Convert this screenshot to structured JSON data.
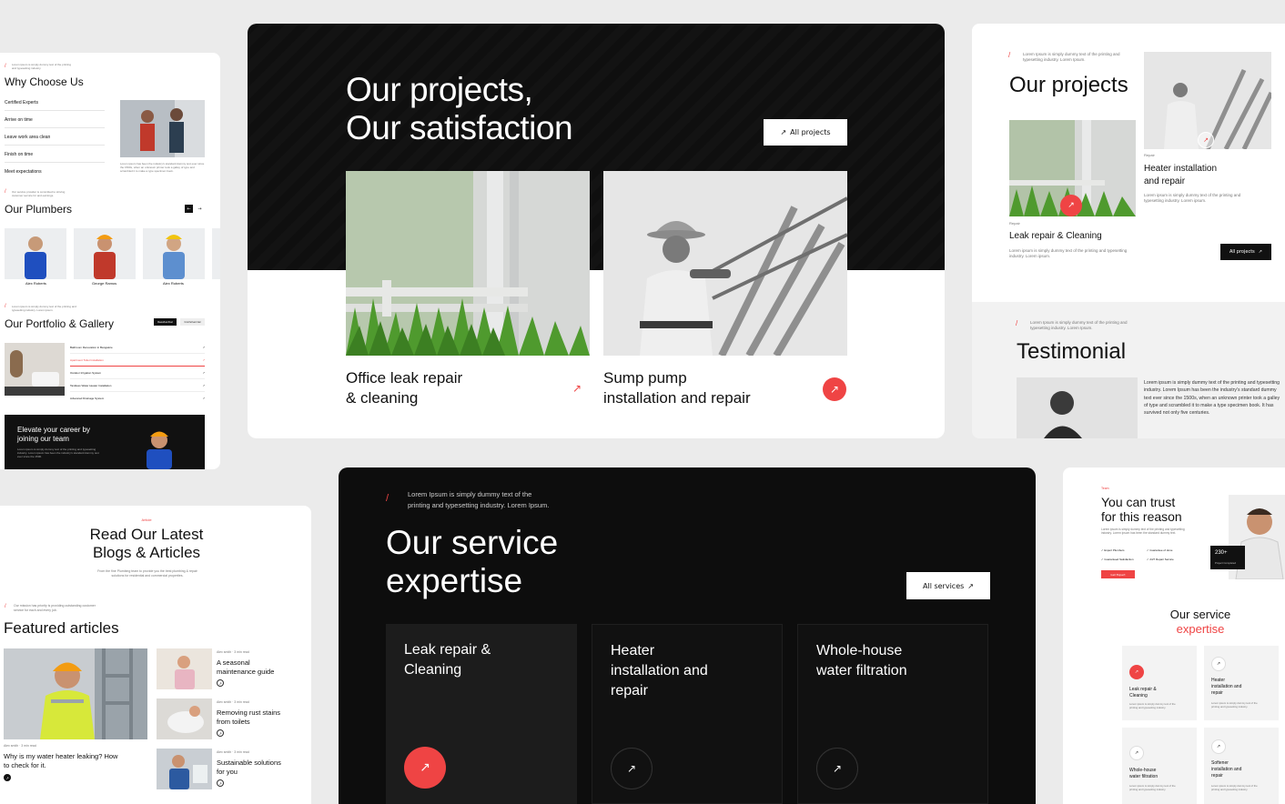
{
  "colors": {
    "accent": "#ef4444",
    "dark": "#111111",
    "light": "#ffffff",
    "bg": "#ebebeb"
  },
  "icons": {
    "arrow": "↗",
    "back": "←",
    "next": "→"
  },
  "hero": {
    "title_line1": "Our projects,",
    "title_line2": "Our satisfaction",
    "all_button": "All projects",
    "projects": [
      {
        "title_line1": "Office leak repair",
        "title_line2": "& cleaning"
      },
      {
        "title_line1": "Sump pump",
        "title_line2": "installation and repair"
      }
    ]
  },
  "why": {
    "intro": "Lorem ipsum is simply dummy text of the printing and typesetting industry.",
    "title": "Why Choose Us",
    "items": [
      "Certified Experts",
      "Arrive on time",
      "Leave work area clean",
      "Finish on time",
      "Meet expectations"
    ],
    "caption": "Lorem ipsum has been the industry's standard dummy text ever since the 1500s, when an unknown printer took a galley of type and scrambled it to make a type specimen book.",
    "plumbers_intro": "Our service provider is committed to striving customer service for and earnings.",
    "plumbers_title": "Our Plumbers",
    "plumbers": [
      "Alex Roberts",
      "George Ramos",
      "Alex Roberts"
    ],
    "portfolio_intro": "Lorem ipsum is simply dummy text of the printing and typesetting industry. Lorem ipsum.",
    "portfolio_title": "Our Portfolio & Gallery",
    "tabs": [
      "Residential",
      "Commercial"
    ],
    "portfolio_items": [
      "Bathroom Renovation in Bangalore",
      "Apartment Toilet Installation",
      "Outdoor Irrigation System",
      "Tankless Water Heater Installation",
      "Advanced Drainage System"
    ],
    "career_title_line1": "Elevate your career by",
    "career_title_line2": "joining our team",
    "career_text": "Lorem ipsum is simply dummy text of the printing and typesetting industry. Lorem ipsum has been the industry's standard dummy text ever since the 1500."
  },
  "projects_card": {
    "intro": "Lorem Ipsum is simply dummy text of the printing and typesetting industry. Lorem Ipsum.",
    "title": "Our projects",
    "item1": {
      "tag": "Repair",
      "title": "Leak repair & Cleaning",
      "text": "Lorem ipsum is simply dummy text of the printing and typesetting industry. Lorem ipsum."
    },
    "item2": {
      "tag": "Repair",
      "title_line1": "Heater installation",
      "title_line2": "and repair",
      "text": "Lorem ipsum is simply dummy text of the printing and typesetting industry. Lorem ipsum."
    },
    "all_button": "All projects"
  },
  "testimonial": {
    "intro": "Lorem Ipsum is simply dummy text of the printing and typesetting industry. Lorem Ipsum.",
    "title": "Testimonial",
    "quote": "Lorem ipsum is simply dummy text of the printing and typesetting industry. Lorem Ipsum has been the industry's standard dummy text ever since the 1500s, when an unknown printer took a galley of type and scrambled it to make a type specimen book. It has survived not only five centuries."
  },
  "blogs": {
    "tag": "Article",
    "title_line1": "Read Our Latest",
    "title_line2": "Blogs & Articles",
    "subtitle": "From the fine Plumbing team to provide you the best plumbing & repair solutions for residential and commercial properties.",
    "featured_intro": "Our mission has priority is providing outstanding customer service for each and every job.",
    "featured_title": "Featured articles",
    "main_meta": "Alex smith · 3 min read",
    "main_title_line1": "Why is my water heater leaking? How",
    "main_title_line2": "to check for it.",
    "side": [
      {
        "meta": "Alex smith · 3 min read",
        "line1": "A seasonal",
        "line2": "maintenance guide"
      },
      {
        "meta": "Alex smith · 3 min read",
        "line1": "Removing rust stains",
        "line2": "from toilets"
      },
      {
        "meta": "Alex smith · 3 min read",
        "line1": "Sustainable solutions",
        "line2": "for you"
      }
    ]
  },
  "services": {
    "intro_line1": "Lorem Ipsum is simply dummy text of the",
    "intro_line2": "printing and typesetting industry. Lorem Ipsum.",
    "title_line1": "Our service",
    "title_line2": "expertise",
    "all_button": "All services",
    "cards": [
      {
        "line1": "Leak repair &",
        "line2": "Cleaning",
        "line3": ""
      },
      {
        "line1": "Heater",
        "line2": "installation and",
        "line3": "repair"
      },
      {
        "line1": "Whole-house",
        "line2": "water filtration",
        "line3": ""
      }
    ]
  },
  "trust": {
    "tag": "Team",
    "title_line1": "You can trust",
    "title_line2": "for this reason",
    "text": "Lorem ipsum is simply dummy text of the printing and typesetting industry. Lorem Ipsum has been the standard dummy text.",
    "features": [
      "Expert Plumbers",
      "Guarantee of done",
      "Guaranteed Satisfaction",
      "24/7 Repair Service"
    ],
    "button": "Get Expert",
    "stat_value": "230+",
    "stat_label": "Project Completed",
    "exp_title_line1": "Our service",
    "exp_title_line2": "expertise",
    "mini": [
      {
        "line1": "Leak repair &",
        "line2": "Cleaning",
        "line3": ""
      },
      {
        "line1": "Heater",
        "line2": "installation and",
        "line3": "repair"
      },
      {
        "line1": "Whole-house",
        "line2": "water filtration",
        "line3": ""
      },
      {
        "line1": "Softener",
        "line2": "installation and",
        "line3": "repair"
      }
    ],
    "mini_text": "Lorem ipsum is simply dummy text of the printing and typesetting industry."
  }
}
